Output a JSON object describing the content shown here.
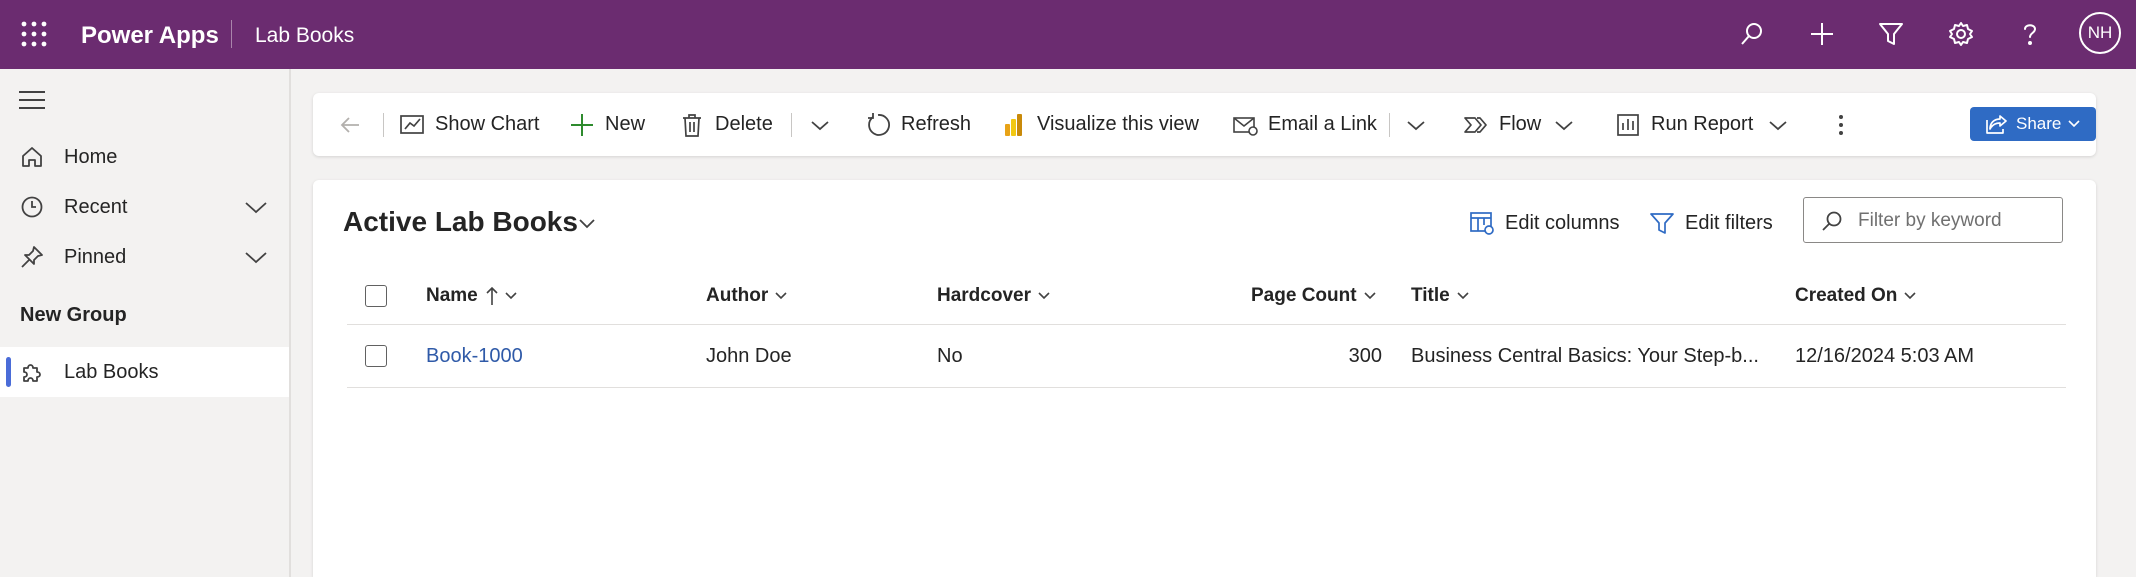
{
  "topbar": {
    "app_name": "Power Apps",
    "context": "Lab Books",
    "avatar_initials": "NH",
    "bg_color": "#6b2c70"
  },
  "sidebar": {
    "items": [
      {
        "label": "Home",
        "icon": "home-icon"
      },
      {
        "label": "Recent",
        "icon": "clock-icon"
      },
      {
        "label": "Pinned",
        "icon": "pin-icon"
      }
    ],
    "group_label": "New Group",
    "group_items": [
      {
        "label": "Lab Books",
        "icon": "puzzle-icon",
        "selected": true
      }
    ]
  },
  "command_bar": {
    "show_chart": "Show Chart",
    "new": "New",
    "delete": "Delete",
    "refresh": "Refresh",
    "visualize": "Visualize this view",
    "email_link": "Email a Link",
    "flow": "Flow",
    "run_report": "Run Report",
    "share": "Share",
    "accent_color": "#2f6bc4"
  },
  "view": {
    "title": "Active Lab Books",
    "edit_columns": "Edit columns",
    "edit_filters": "Edit filters",
    "filter_placeholder": "Filter by keyword"
  },
  "grid": {
    "columns": [
      {
        "key": "name",
        "label": "Name",
        "sorted": "ascending"
      },
      {
        "key": "author",
        "label": "Author"
      },
      {
        "key": "hardcover",
        "label": "Hardcover"
      },
      {
        "key": "page_count",
        "label": "Page Count"
      },
      {
        "key": "title",
        "label": "Title"
      },
      {
        "key": "created_on",
        "label": "Created On"
      }
    ],
    "rows": [
      {
        "name": "Book-1000",
        "author": "John Doe",
        "hardcover": "No",
        "page_count": "300",
        "title": "Business Central Basics: Your Step-b...",
        "created_on": "12/16/2024 5:03 AM"
      }
    ]
  }
}
